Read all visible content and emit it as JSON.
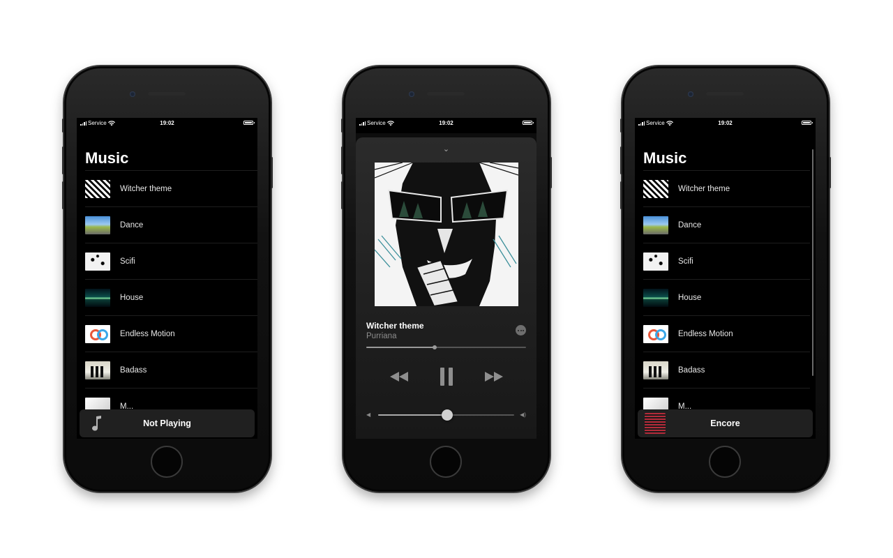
{
  "status_bar": {
    "carrier": "Service",
    "time": "19:02"
  },
  "phone_left": {
    "library_title": "Music",
    "tracks": [
      {
        "label": "Witcher theme"
      },
      {
        "label": "Dance"
      },
      {
        "label": "Scifi"
      },
      {
        "label": "House"
      },
      {
        "label": "Endless Motion"
      },
      {
        "label": "Badass"
      },
      {
        "label": "M..."
      }
    ],
    "miniplayer": {
      "title": "Not Playing",
      "icon": "music-note-icon"
    }
  },
  "phone_center": {
    "grabber": "⌄",
    "now_playing": {
      "title": "Witcher theme",
      "artist": "Purriana"
    },
    "progress_fraction": 0.43,
    "volume_fraction": 0.51,
    "icons": [
      "rewind-icon",
      "pause-icon",
      "fast-forward-icon",
      "more-icon",
      "volume-low-icon",
      "volume-high-icon"
    ]
  },
  "phone_right": {
    "library_title": "Music",
    "tracks": [
      {
        "label": "Witcher theme"
      },
      {
        "label": "Dance"
      },
      {
        "label": "Scifi"
      },
      {
        "label": "House"
      },
      {
        "label": "Endless Motion"
      },
      {
        "label": "Badass"
      },
      {
        "label": "M..."
      }
    ],
    "miniplayer": {
      "title": "Encore"
    }
  },
  "colors": {
    "screen_bg": "#000000",
    "sheet_bg": "#202020",
    "text_secondary": "#8e8e8e"
  }
}
